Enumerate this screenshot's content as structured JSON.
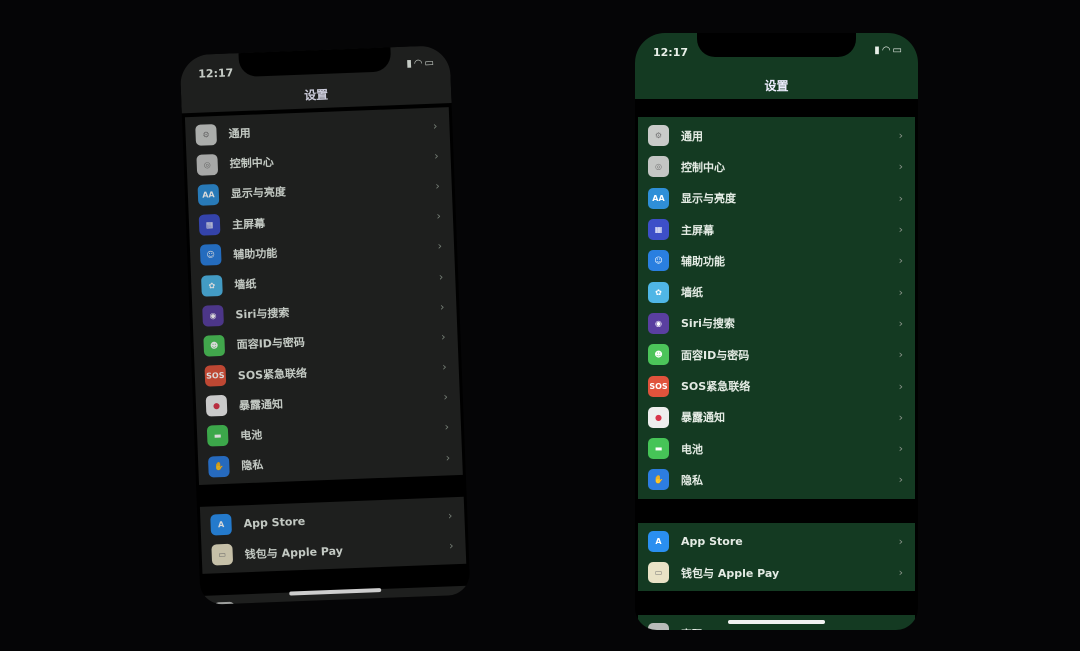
{
  "phones": [
    {
      "id": "left",
      "time": "12:17",
      "title": "设置",
      "screen_color": "#232423",
      "status_icons": [
        "signal-icon",
        "wifi-icon",
        "battery-icon"
      ]
    },
    {
      "id": "right",
      "time": "12:17",
      "title": "设置",
      "screen_color": "#143a22",
      "status_icons": [
        "signal-icon",
        "wifi-icon",
        "battery-icon"
      ]
    }
  ],
  "groups": [
    [
      {
        "label": "通用",
        "icon": "gear-icon",
        "color": "#c9cbc9",
        "glyph": "⚙"
      },
      {
        "label": "控制中心",
        "icon": "control-center-icon",
        "color": "#c4c6c4",
        "glyph": "◎"
      },
      {
        "label": "显示与亮度",
        "icon": "display-brightness-icon",
        "color": "#2f8fd8",
        "glyph": "AA"
      },
      {
        "label": "主屏幕",
        "icon": "home-screen-icon",
        "color": "#3d4fc8",
        "glyph": "▦"
      },
      {
        "label": "辅助功能",
        "icon": "accessibility-icon",
        "color": "#2a7fe0",
        "glyph": "☺"
      },
      {
        "label": "墙纸",
        "icon": "wallpaper-icon",
        "color": "#4fb6e6",
        "glyph": "✿"
      },
      {
        "label": "Siri与搜索",
        "icon": "siri-icon",
        "color": "#5a3fa0",
        "glyph": "◉"
      },
      {
        "label": "面容ID与密码",
        "icon": "face-id-icon",
        "color": "#4cc45a",
        "glyph": "☻"
      },
      {
        "label": "SOS紧急联络",
        "icon": "sos-icon",
        "color": "#e0533c",
        "glyph": "SOS"
      },
      {
        "label": "暴露通知",
        "icon": "exposure-notification-icon",
        "color": "#eeeeee",
        "glyph": "●"
      },
      {
        "label": "电池",
        "icon": "battery-settings-icon",
        "color": "#46c457",
        "glyph": "▬"
      },
      {
        "label": "隐私",
        "icon": "privacy-hand-icon",
        "color": "#2d7de0",
        "glyph": "✋"
      }
    ],
    [
      {
        "label": "App Store",
        "icon": "app-store-icon",
        "color": "#2a8ff0",
        "glyph": "A"
      },
      {
        "label": "钱包与 Apple Pay",
        "icon": "wallet-icon",
        "color": "#e9e2c6",
        "glyph": "▭"
      }
    ],
    [
      {
        "label": "密码",
        "icon": "key-icon",
        "color": "#b9bbb9",
        "glyph": "⚷"
      }
    ]
  ],
  "chevron": "›"
}
